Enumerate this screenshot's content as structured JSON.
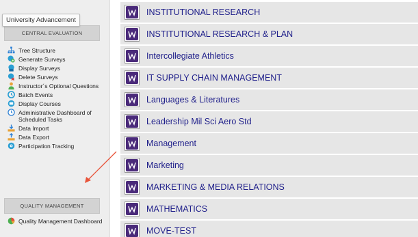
{
  "tooltip": "University Advancement",
  "sidebar": {
    "central_header": "CENTRAL EVALUATION",
    "central_items": [
      {
        "label": "Tree Structure",
        "icon": "tree-structure-icon"
      },
      {
        "label": "Generate Surveys",
        "icon": "generate-surveys-icon"
      },
      {
        "label": "Display Surveys",
        "icon": "display-surveys-icon"
      },
      {
        "label": "Delete Surveys",
        "icon": "delete-surveys-icon"
      },
      {
        "label": "Instructor´s Optional Questions",
        "icon": "person-icon"
      },
      {
        "label": "Batch Events",
        "icon": "batch-events-icon"
      },
      {
        "label": "Display Courses",
        "icon": "display-courses-icon"
      },
      {
        "label": "Administrative Dashboard of Scheduled Tasks",
        "icon": "clock-icon"
      },
      {
        "label": "Data Import",
        "icon": "data-import-icon"
      },
      {
        "label": "Data Export",
        "icon": "data-export-icon"
      },
      {
        "label": "Participation Tracking",
        "icon": "participation-tracking-icon"
      }
    ],
    "quality_header": "QUALITY MANAGEMENT",
    "quality_items": [
      {
        "label": "Quality Management Dashboard",
        "icon": "pie-chart-icon"
      }
    ]
  },
  "departments": [
    "INSTITUTIONAL RESEARCH",
    "INSTITUTIONAL RESEARCH & PLAN",
    "Intercollegiate Athletics",
    "IT SUPPLY CHAIN MANAGEMENT",
    "Languages & Literatures",
    "Leadership Mil Sci Aero Std",
    "Management",
    "Marketing",
    "MARKETING & MEDIA RELATIONS",
    "MATHEMATICS",
    "MOVE-TEST"
  ],
  "colors": {
    "department_text": "#1f1f8a",
    "logo_purple": "#4a2a7a",
    "annotation_arrow": "#e8543a"
  }
}
